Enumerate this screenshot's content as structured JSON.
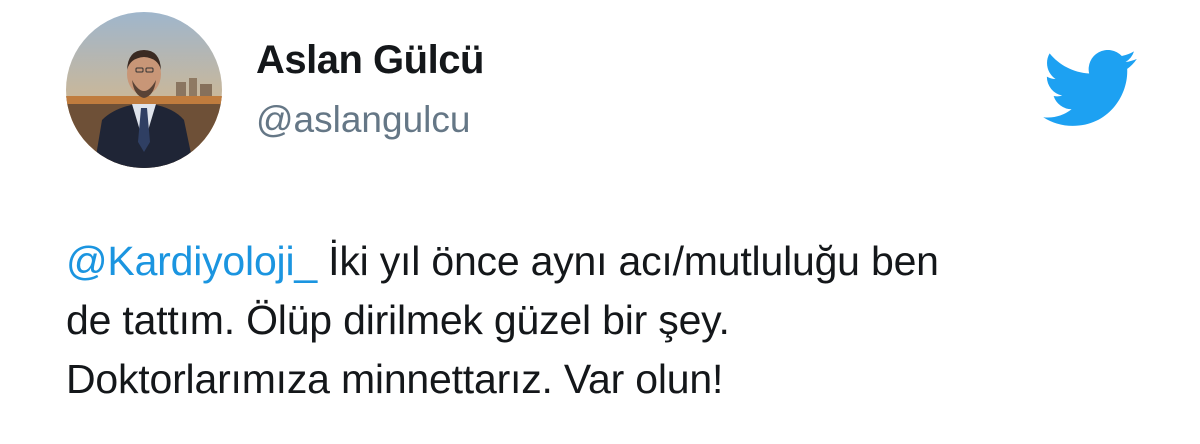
{
  "user": {
    "display_name": "Aslan Gülcü",
    "handle": "@aslangulcu",
    "avatar_icon": "profile-photo"
  },
  "brand": {
    "icon": "twitter-bird-icon",
    "color": "#1da1f2"
  },
  "tweet": {
    "mention": "@Kardiyoloji_",
    "line1_rest": " İki yıl önce aynı acı/mutluluğu ben",
    "line2": "de tattım. Ölüp dirilmek güzel bir şey.",
    "line3": "Doktorlarımıza minnettarız. Var olun!"
  },
  "colors": {
    "mention": "#1b95e0",
    "text": "#14171a",
    "handle": "#657786"
  }
}
